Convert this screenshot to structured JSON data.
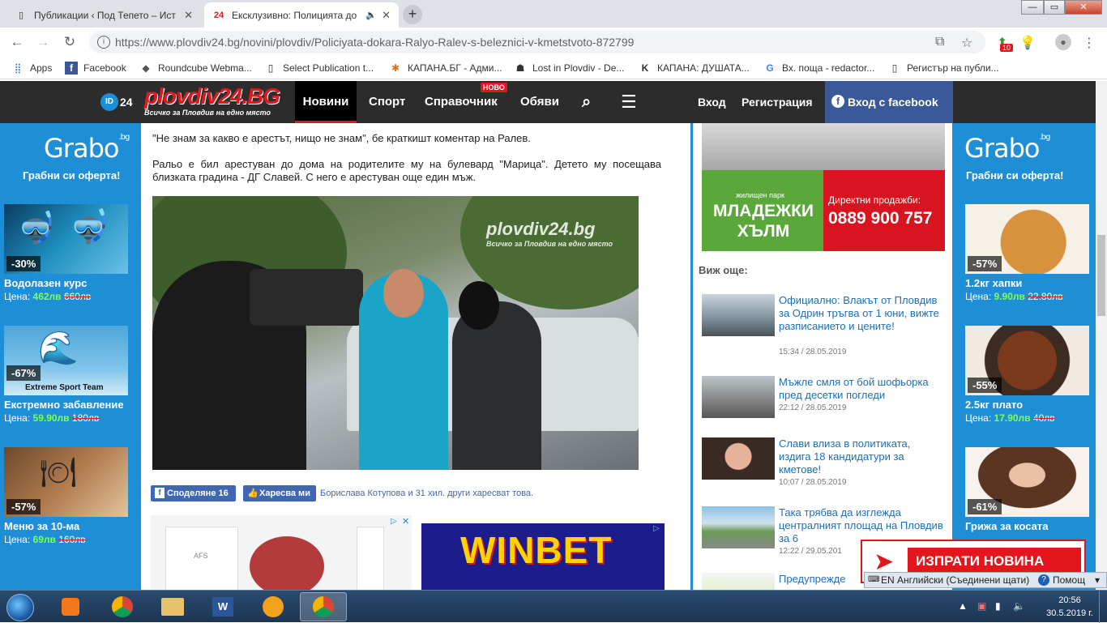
{
  "browser": {
    "tabs": [
      {
        "title": "Публикации ‹ Под Тепето – Ист",
        "favicon": "document-icon"
      },
      {
        "title": "Ексклузивно: Полицията до",
        "favicon": "plovdiv24-icon",
        "audio": "🔈"
      }
    ],
    "window_controls": {
      "minimize": "—",
      "maximize": "▭",
      "close": "✕"
    },
    "url": {
      "host": "https://www.plovdiv24.bg",
      "path": "/novini/plovdiv/Policiyata-dokara-Ralyo-Ralev-s-beleznici-v-kmetstvoto-872799"
    },
    "extension_badge": "10",
    "bookmarks": [
      {
        "label": "Apps",
        "icon": "⣿"
      },
      {
        "label": "Facebook",
        "icon": "f"
      },
      {
        "label": "Roundcube Webma...",
        "icon": "◆"
      },
      {
        "label": "Select Publication t...",
        "icon": "▯"
      },
      {
        "label": "КАПАНА.БГ - Адми...",
        "icon": "✱"
      },
      {
        "label": "Lost in Plovdiv - De...",
        "icon": "☗"
      },
      {
        "label": "КАПАНА: ДУШАТА...",
        "icon": "K"
      },
      {
        "label": "Вх. поща - redactor...",
        "icon": "G"
      },
      {
        "label": "Регистър на публи...",
        "icon": "▯"
      }
    ]
  },
  "site": {
    "id_badge": "ID",
    "id_num": "24",
    "logo": "plovdiv24.BG",
    "logo_tag": "Всичко за Пловдив на едно място",
    "nav": [
      "Новини",
      "Спорт",
      "Справочник",
      "Обяви"
    ],
    "novo_badge": "НОВО",
    "login": "Вход",
    "register": "Регистрация",
    "fb_login": "Вход с facebook"
  },
  "grabo_left": {
    "logo": "Grabo",
    "logo_sup": ".bg",
    "tagline": "Грабни си оферта!",
    "deals": [
      {
        "pct": "-30%",
        "title": "Водолазен курс",
        "price_label": "Цена:",
        "new_price": "462лв",
        "old_price": "660лв"
      },
      {
        "pct": "-67%",
        "title": "Екстремно забавление",
        "price_label": "Цена:",
        "new_price": "59.90лв",
        "old_price": "180лв",
        "img_text": "Extreme Sport Team"
      },
      {
        "pct": "-57%",
        "title": "Меню за 10-ма",
        "price_label": "Цена:",
        "new_price": "69лв",
        "old_price": "160лв"
      }
    ]
  },
  "grabo_right": {
    "logo": "Grabo",
    "logo_sup": ".bg",
    "tagline": "Грабни си оферта!",
    "deals": [
      {
        "pct": "-57%",
        "title": "1.2кг хапки",
        "price_label": "Цена:",
        "new_price": "9.90лв",
        "old_price": "22.80лв"
      },
      {
        "pct": "-55%",
        "title": "2.5кг плато",
        "price_label": "Цена:",
        "new_price": "17.90лв",
        "old_price": "40лв"
      },
      {
        "pct": "-61%",
        "title": "Грижа за косата",
        "price_label": "",
        "new_price": "",
        "old_price": ""
      }
    ]
  },
  "article": {
    "para1": "\"Не знам за какво е арестът, нищо не знам\", бе краткишт коментар на Ралев.",
    "para2": "Ральо е бил арестуван до дома на родителите му на булевард \"Марица\". Детето му посещава близката градина - ДГ Славей. С него е арестуван още един мъж.",
    "video_watermark": "plovdiv24.bg",
    "video_watermark_sub": "Всичко за Пловдив на едно място",
    "share_label": "Споделяне 16",
    "like_label": "Харесва ми",
    "like_name": "Борислава Котупова",
    "like_rest": " и 31 хил. други харесват това."
  },
  "ads": {
    "winbet": "WINBET",
    "adchoices": "▷",
    "close": "✕",
    "cosmetic_brand": "AFS",
    "realestate_small": "жилищен парк",
    "realestate_name": "МЛАДЕЖКИ ХЪЛМ",
    "realestate_cta": "Директни продажби:",
    "realestate_phone": "0889 900 757"
  },
  "see_more": {
    "heading": "Виж още:",
    "items": [
      {
        "title": "Официално: Влакът от Пловдив за Одрин тръгва от 1 юни, вижте разписанието и цените!",
        "date": "15:34 / 28.05.2019"
      },
      {
        "title": "Мъжле смля от бой шофьорка пред десетки погледи",
        "date": "22:12 / 28.05.2019"
      },
      {
        "title": "Слави влиза в политиката, издига 18 кандидатури за кметове!",
        "date": "10:07 / 28.05.2019"
      },
      {
        "title": "Така трябва да изглежда централният площад на Пловдив за 6",
        "date": "12:22 / 29.05.201"
      },
      {
        "title": "Предупрежде",
        "date": ""
      }
    ]
  },
  "send_news": "ИЗПРАТИ НОВИНА",
  "language_bar": {
    "lang": "EN Английски (Съединени щати)",
    "help": "Помощ"
  },
  "taskbar": {
    "time": "20:56",
    "date": "30.5.2019 г."
  }
}
